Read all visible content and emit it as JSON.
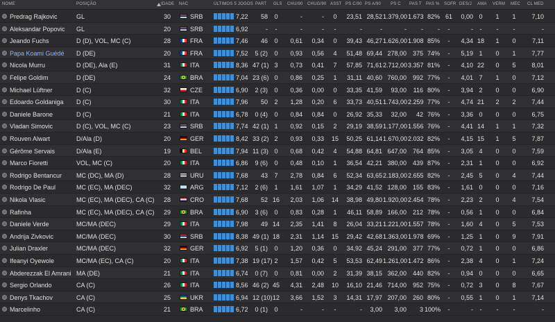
{
  "headers": {
    "nome": "NOME",
    "posicao": "POSIÇÃO",
    "idade": "IDADE",
    "nac": "NAC",
    "ultimos5": "ÚLTIMOS 5 JOGOS",
    "part": "PART",
    "gls": "GLS",
    "chu90": "CHU/90",
    "chug90": "CHUG/90",
    "asst": "ASST",
    "psc90": "PS C/90",
    "psa90": "PS A/90",
    "psc": "PS C",
    "pst": "PAS T",
    "paspct": "PAS %",
    "sofr": "SOFR",
    "desj": "DES/J",
    "ama": "AMA",
    "verm": "VERM",
    "mec": "MEC",
    "clmed": "CL MED"
  },
  "colors": {
    "accent": "#3d8fd9",
    "highlight_name": "#8fb4ff"
  },
  "players": [
    {
      "name": "Predrag Rajkovic",
      "pos": "GL",
      "age": "30",
      "nat": "SRB",
      "form": "7,22",
      "part": "58",
      "gls": "0",
      "chu": "-",
      "chug": "-",
      "asst": "0",
      "psc90": "23,51",
      "psa90": "28,52",
      "psc": "1.379,00",
      "pst": "1.673",
      "paspct": "82%",
      "sofr": "61",
      "desj": "0,00",
      "ama": "0",
      "verm": "1",
      "mec": "1",
      "clmed": "7,10",
      "hl": false
    },
    {
      "name": "Aleksandar Popovic",
      "pos": "GL",
      "age": "20",
      "nat": "SRB",
      "form": "6,92",
      "part": "-",
      "gls": "-",
      "chu": "-",
      "chug": "-",
      "asst": "-",
      "psc90": "-",
      "psa90": "-",
      "psc": "-",
      "pst": "-",
      "paspct": "-",
      "sofr": "-",
      "desj": "-",
      "ama": "-",
      "verm": "-",
      "mec": "-",
      "clmed": "-",
      "hl": false
    },
    {
      "name": "Jeando Fuchs",
      "pos": "D (D), VOL, MC (C)",
      "age": "28",
      "nat": "FRA",
      "form": "7,46",
      "part": "46",
      "gls": "0",
      "chu": "0,61",
      "chug": "0,34",
      "asst": "0",
      "psc90": "39,43",
      "psa90": "46,27",
      "psc": "1.626,00",
      "pst": "1.908",
      "paspct": "85%",
      "sofr": "-",
      "desj": "4,34",
      "ama": "18",
      "verm": "1",
      "mec": "0",
      "clmed": "7,11",
      "hl": false
    },
    {
      "name": "Papa Koami Guédé",
      "pos": "D (DE)",
      "age": "20",
      "nat": "FRA",
      "form": "7,52",
      "part": "5 (2)",
      "gls": "0",
      "chu": "0,93",
      "chug": "0,56",
      "asst": "4",
      "psc90": "51,48",
      "psa90": "69,44",
      "psc": "278,00",
      "pst": "375",
      "paspct": "74%",
      "sofr": "-",
      "desj": "5,19",
      "ama": "1",
      "verm": "0",
      "mec": "1",
      "clmed": "7,77",
      "hl": true
    },
    {
      "name": "Nicola Murru",
      "pos": "D (DE), Ala (E)",
      "age": "31",
      "nat": "ITA",
      "form": "8,36",
      "part": "47 (1)",
      "gls": "3",
      "chu": "0,73",
      "chug": "0,41",
      "asst": "7",
      "psc90": "57,85",
      "psa90": "71,61",
      "psc": "2.712,00",
      "pst": "3.357",
      "paspct": "81%",
      "sofr": "-",
      "desj": "4,10",
      "ama": "22",
      "verm": "0",
      "mec": "5",
      "clmed": "8,01",
      "hl": false
    },
    {
      "name": "Felipe Goldim",
      "pos": "D (DE)",
      "age": "24",
      "nat": "BRA",
      "form": "7,04",
      "part": "23 (6)",
      "gls": "0",
      "chu": "0,86",
      "chug": "0,25",
      "asst": "1",
      "psc90": "31,11",
      "psa90": "40,60",
      "psc": "760,00",
      "pst": "992",
      "paspct": "77%",
      "sofr": "-",
      "desj": "4,01",
      "ama": "7",
      "verm": "1",
      "mec": "0",
      "clmed": "7,12",
      "hl": false
    },
    {
      "name": "Michael Lüftner",
      "pos": "D (C)",
      "age": "32",
      "nat": "CZE",
      "form": "6,90",
      "part": "2 (3)",
      "gls": "0",
      "chu": "0,36",
      "chug": "0,00",
      "asst": "0",
      "psc90": "33,35",
      "psa90": "41,59",
      "psc": "93,00",
      "pst": "116",
      "paspct": "80%",
      "sofr": "-",
      "desj": "3,94",
      "ama": "2",
      "verm": "0",
      "mec": "0",
      "clmed": "6,90",
      "hl": false
    },
    {
      "name": "Edoardo Goldaniga",
      "pos": "D (C)",
      "age": "30",
      "nat": "ITA",
      "form": "7,96",
      "part": "50",
      "gls": "2",
      "chu": "1,28",
      "chug": "0,20",
      "asst": "6",
      "psc90": "33,73",
      "psa90": "40,51",
      "psc": "1.743,00",
      "pst": "2.259",
      "paspct": "77%",
      "sofr": "-",
      "desj": "4,74",
      "ama": "21",
      "verm": "2",
      "mec": "2",
      "clmed": "7,44",
      "hl": false
    },
    {
      "name": "Daniele Barone",
      "pos": "D (C)",
      "age": "21",
      "nat": "ITA",
      "form": "6,78",
      "part": "0 (4)",
      "gls": "0",
      "chu": "0,84",
      "chug": "0,84",
      "asst": "0",
      "psc90": "26,92",
      "psa90": "35,33",
      "psc": "32,00",
      "pst": "42",
      "paspct": "76%",
      "sofr": "-",
      "desj": "3,36",
      "ama": "0",
      "verm": "0",
      "mec": "0",
      "clmed": "6,75",
      "hl": false
    },
    {
      "name": "Vladan Simovic",
      "pos": "D (C), VOL, MC (C)",
      "age": "23",
      "nat": "SRB",
      "form": "7,74",
      "part": "42 (1)",
      "gls": "1",
      "chu": "0,92",
      "chug": "0,15",
      "asst": "2",
      "psc90": "29,19",
      "psa90": "38,59",
      "psc": "1.177,00",
      "pst": "1.556",
      "paspct": "76%",
      "sofr": "-",
      "desj": "4,41",
      "ama": "14",
      "verm": "1",
      "mec": "1",
      "clmed": "7,32",
      "hl": false
    },
    {
      "name": "Rouven Alwart",
      "pos": "D/Ala (D)",
      "age": "20",
      "nat": "GER",
      "form": "8,42",
      "part": "33 (2)",
      "gls": "2",
      "chu": "0,93",
      "chug": "0,33",
      "asst": "15",
      "psc90": "50,25",
      "psa90": "61,14",
      "psc": "1.670,00",
      "pst": "2.032",
      "paspct": "82%",
      "sofr": "-",
      "desj": "4,15",
      "ama": "15",
      "verm": "1",
      "mec": "5",
      "clmed": "7,87",
      "hl": false
    },
    {
      "name": "Gérôme Servais",
      "pos": "D/Ala (E)",
      "age": "19",
      "nat": "BEL",
      "form": "7,94",
      "part": "11 (3)",
      "gls": "0",
      "chu": "0,68",
      "chug": "0,42",
      "asst": "4",
      "psc90": "54,88",
      "psa90": "64,81",
      "psc": "647,00",
      "pst": "764",
      "paspct": "85%",
      "sofr": "-",
      "desj": "3,05",
      "ama": "4",
      "verm": "0",
      "mec": "0",
      "clmed": "7,59",
      "hl": false
    },
    {
      "name": "Marco Fioretti",
      "pos": "VOL, MC (C)",
      "age": "20",
      "nat": "ITA",
      "form": "6,86",
      "part": "9 (6)",
      "gls": "0",
      "chu": "0,48",
      "chug": "0,10",
      "asst": "1",
      "psc90": "36,54",
      "psa90": "42,21",
      "psc": "380,00",
      "pst": "439",
      "paspct": "87%",
      "sofr": "-",
      "desj": "2,31",
      "ama": "1",
      "verm": "0",
      "mec": "0",
      "clmed": "6,92",
      "hl": false
    },
    {
      "name": "Rodrigo Bentancur",
      "pos": "MC (DC), MA (D)",
      "age": "28",
      "nat": "URU",
      "form": "7,68",
      "part": "43",
      "gls": "7",
      "chu": "2,78",
      "chug": "0,84",
      "asst": "6",
      "psc90": "52,34",
      "psa90": "63,65",
      "psc": "2.183,00",
      "pst": "2.655",
      "paspct": "82%",
      "sofr": "-",
      "desj": "2,45",
      "ama": "5",
      "verm": "0",
      "mec": "4",
      "clmed": "7,44",
      "hl": false
    },
    {
      "name": "Rodrigo De Paul",
      "pos": "MC (EC), MA (DEC)",
      "age": "32",
      "nat": "ARG",
      "form": "7,12",
      "part": "2 (6)",
      "gls": "1",
      "chu": "1,61",
      "chug": "1,07",
      "asst": "1",
      "psc90": "34,29",
      "psa90": "41,52",
      "psc": "128,00",
      "pst": "155",
      "paspct": "83%",
      "sofr": "-",
      "desj": "1,61",
      "ama": "0",
      "verm": "0",
      "mec": "0",
      "clmed": "7,16",
      "hl": false
    },
    {
      "name": "Nikola Vlasic",
      "pos": "MC (EC), MA (DEC), CA (C)",
      "age": "28",
      "nat": "CRO",
      "form": "7,68",
      "part": "52",
      "gls": "16",
      "chu": "2,03",
      "chug": "1,06",
      "asst": "14",
      "psc90": "38,98",
      "psa90": "49,80",
      "psc": "1.920,00",
      "pst": "2.454",
      "paspct": "78%",
      "sofr": "-",
      "desj": "2,23",
      "ama": "2",
      "verm": "0",
      "mec": "4",
      "clmed": "7,54",
      "hl": false
    },
    {
      "name": "Rafinha",
      "pos": "MC (EC), MA (DEC), CA (C)",
      "age": "29",
      "nat": "BRA",
      "form": "6,90",
      "part": "3 (6)",
      "gls": "0",
      "chu": "0,83",
      "chug": "0,28",
      "asst": "1",
      "psc90": "46,11",
      "psa90": "58,89",
      "psc": "166,00",
      "pst": "212",
      "paspct": "78%",
      "sofr": "-",
      "desj": "0,56",
      "ama": "1",
      "verm": "0",
      "mec": "0",
      "clmed": "6,84",
      "hl": false
    },
    {
      "name": "Daniele Verde",
      "pos": "MC/MA (DEC)",
      "age": "29",
      "nat": "ITA",
      "form": "7,98",
      "part": "49",
      "gls": "14",
      "chu": "2,35",
      "chug": "1,41",
      "asst": "8",
      "psc90": "26,04",
      "psa90": "33,21",
      "psc": "1.221,00",
      "pst": "1.557",
      "paspct": "78%",
      "sofr": "-",
      "desj": "1,60",
      "ama": "4",
      "verm": "0",
      "mec": "5",
      "clmed": "7,53",
      "hl": false
    },
    {
      "name": "Andrija Zivkovic",
      "pos": "MC/MA (DEC)",
      "age": "30",
      "nat": "SRB",
      "form": "8,38",
      "part": "49 (1)",
      "gls": "18",
      "chu": "2,31",
      "chug": "1,14",
      "asst": "15",
      "psc90": "29,42",
      "psa90": "42,68",
      "psc": "1.363,00",
      "pst": "1.978",
      "paspct": "69%",
      "sofr": "-",
      "desj": "1,25",
      "ama": "1",
      "verm": "0",
      "mec": "9",
      "clmed": "7,91",
      "hl": false
    },
    {
      "name": "Julian Draxler",
      "pos": "MC/MA (DEC)",
      "age": "32",
      "nat": "GER",
      "form": "6,92",
      "part": "5 (1)",
      "gls": "0",
      "chu": "1,20",
      "chug": "0,36",
      "asst": "0",
      "psc90": "34,92",
      "psa90": "45,24",
      "psc": "291,00",
      "pst": "377",
      "paspct": "77%",
      "sofr": "-",
      "desj": "0,72",
      "ama": "1",
      "verm": "0",
      "mec": "0",
      "clmed": "6,86",
      "hl": false
    },
    {
      "name": "Ifeanyi Oyewole",
      "pos": "MC/MA (EC), CA (C)",
      "age": "20",
      "nat": "ITA",
      "form": "7,38",
      "part": "19 (17)",
      "gls": "2",
      "chu": "1,57",
      "chug": "0,42",
      "asst": "5",
      "psc90": "53,53",
      "psa90": "62,49",
      "psc": "1.261,00",
      "pst": "1.472",
      "paspct": "86%",
      "sofr": "-",
      "desj": "2,38",
      "ama": "4",
      "verm": "0",
      "mec": "1",
      "clmed": "7,24",
      "hl": false
    },
    {
      "name": "Abderezzak El Amrani",
      "pos": "MA (DE)",
      "age": "21",
      "nat": "ITA",
      "form": "6,74",
      "part": "0 (7)",
      "gls": "0",
      "chu": "0,81",
      "chug": "0,00",
      "asst": "2",
      "psc90": "31,39",
      "psa90": "38,15",
      "psc": "362,00",
      "pst": "440",
      "paspct": "82%",
      "sofr": "-",
      "desj": "0,94",
      "ama": "0",
      "verm": "0",
      "mec": "0",
      "clmed": "6,65",
      "hl": false
    },
    {
      "name": "Sergio Orlando",
      "pos": "CA (C)",
      "age": "26",
      "nat": "ITA",
      "form": "8,56",
      "part": "46 (2)",
      "gls": "45",
      "chu": "4,31",
      "chug": "2,48",
      "asst": "10",
      "psc90": "16,10",
      "psa90": "21,46",
      "psc": "714,00",
      "pst": "952",
      "paspct": "75%",
      "sofr": "-",
      "desj": "0,72",
      "ama": "3",
      "verm": "0",
      "mec": "8",
      "clmed": "7,67",
      "hl": false
    },
    {
      "name": "Denys Tkachov",
      "pos": "CA (C)",
      "age": "25",
      "nat": "UKR",
      "form": "6,94",
      "part": "12 (10)",
      "gls": "12",
      "chu": "3,66",
      "chug": "1,52",
      "asst": "3",
      "psc90": "14,31",
      "psa90": "17,97",
      "psc": "207,00",
      "pst": "260",
      "paspct": "80%",
      "sofr": "-",
      "desj": "0,55",
      "ama": "1",
      "verm": "0",
      "mec": "1",
      "clmed": "7,14",
      "hl": false
    },
    {
      "name": "Marcelinho",
      "pos": "CA (C)",
      "age": "21",
      "nat": "BRA",
      "form": "6,72",
      "part": "0 (1)",
      "gls": "0",
      "chu": "-",
      "chug": "-",
      "asst": "-",
      "psc90": "-",
      "psa90": "3,00",
      "psc": "3,00",
      "pst": "3",
      "paspct": "100%",
      "sofr": "-",
      "desj": "-",
      "ama": "-",
      "verm": "-",
      "mec": "-",
      "clmed": "-",
      "hl": false
    }
  ]
}
